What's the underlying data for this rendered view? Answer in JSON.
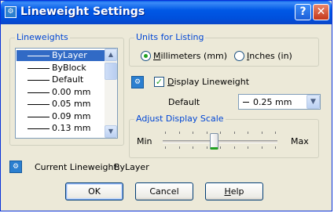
{
  "window": {
    "title": "Lineweight Settings",
    "help_glyph": "?",
    "close_glyph": "✕"
  },
  "lineweights": {
    "legend": "Lineweights",
    "items": [
      {
        "label": "ByLayer",
        "selected": true
      },
      {
        "label": "ByBlock",
        "selected": false
      },
      {
        "label": "Default",
        "selected": false
      },
      {
        "label": "0.00 mm",
        "selected": false
      },
      {
        "label": "0.05 mm",
        "selected": false
      },
      {
        "label": "0.09 mm",
        "selected": false
      },
      {
        "label": "0.13 mm",
        "selected": false
      }
    ]
  },
  "units": {
    "legend": "Units for Listing",
    "millimeters": {
      "prefix": "",
      "accel": "M",
      "rest": "illimeters (mm)",
      "checked": true
    },
    "inches": {
      "prefix": "",
      "accel": "I",
      "rest": "nches (in)",
      "checked": false
    }
  },
  "display_lineweight": {
    "accel": "D",
    "rest": "isplay Lineweight",
    "checked": true
  },
  "default": {
    "label": "Default",
    "value": "0.25 mm"
  },
  "scale": {
    "legend": "Adjust Display Scale",
    "min_label": "Min",
    "max_label": "Max",
    "position_fraction": 0.42
  },
  "current": {
    "label": "Current Lineweight:",
    "value": "ByLayer"
  },
  "buttons": {
    "ok": "OK",
    "cancel": "Cancel",
    "help_accel": "H",
    "help_rest": "elp"
  },
  "colors": {
    "title_blue": "#0058e6",
    "selection": "#316ac5",
    "legend_blue": "#0046d5",
    "check_green": "#21a121"
  }
}
